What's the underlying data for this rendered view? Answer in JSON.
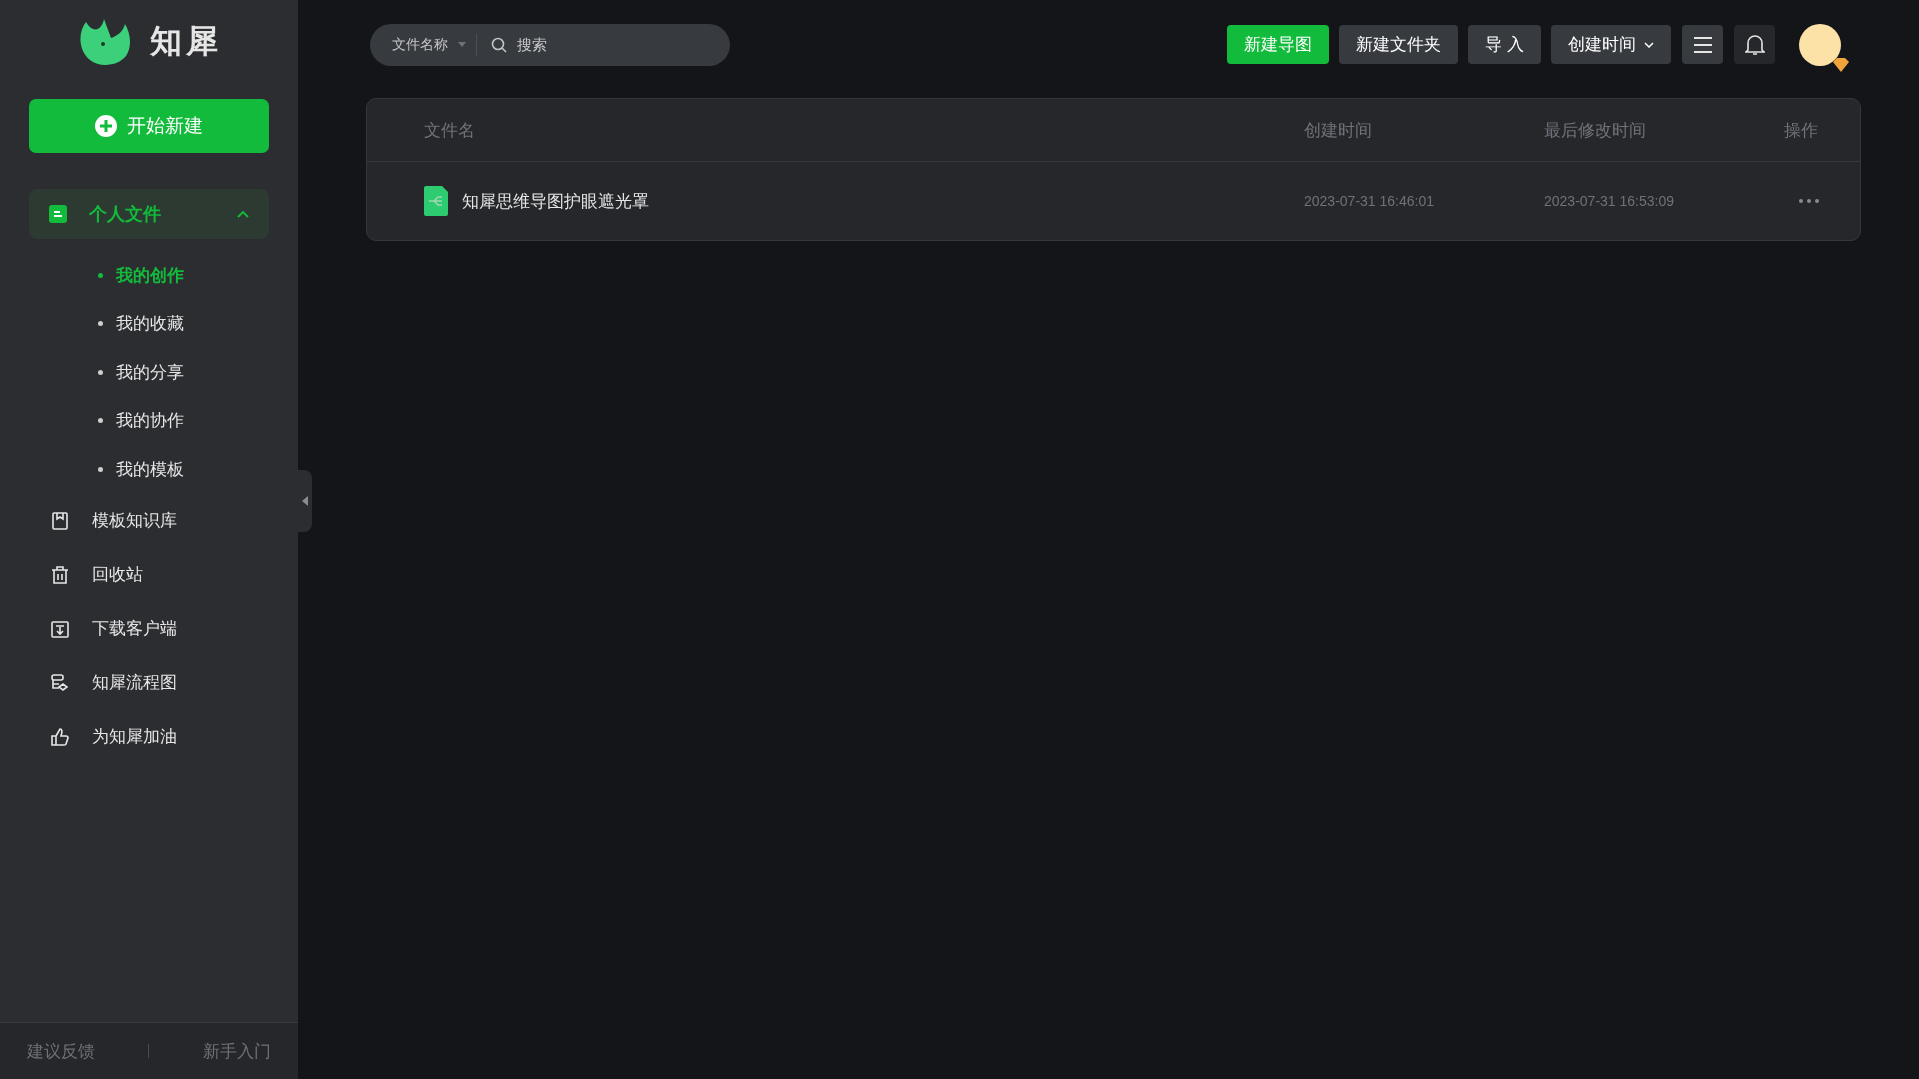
{
  "sidebar": {
    "logo_text": "知犀",
    "new_button": "开始新建",
    "group": {
      "label": "个人文件",
      "expanded": true,
      "selected": true,
      "children": [
        {
          "label": "我的创作",
          "selected": true
        },
        {
          "label": "我的收藏",
          "selected": false
        },
        {
          "label": "我的分享",
          "selected": false
        },
        {
          "label": "我的协作",
          "selected": false
        },
        {
          "label": "我的模板",
          "selected": false
        }
      ]
    },
    "items": [
      {
        "label": "模板知识库",
        "kind": "bookmark"
      },
      {
        "label": "回收站",
        "kind": "trash"
      },
      {
        "label": "下载客户端",
        "kind": "download"
      },
      {
        "label": "知犀流程图",
        "kind": "flow"
      },
      {
        "label": "为知犀加油",
        "kind": "like"
      }
    ],
    "footer": [
      "建议反馈",
      "新手入门"
    ]
  },
  "search": {
    "scope": "文件名称",
    "placeholder": "搜索"
  },
  "toolbar": [
    {
      "label": "新建导图",
      "kind": "primary"
    },
    {
      "label": "新建文件夹",
      "kind": "secondary"
    },
    {
      "label": "导 入",
      "kind": "secondary"
    },
    {
      "label": "创建时间",
      "kind": "dropdown"
    }
  ],
  "table": {
    "columns": [
      "文件名",
      "创建时间",
      "最后修改时间",
      "操作"
    ],
    "rows": [
      {
        "name": "知犀思维导图护眼遮光罩",
        "created": "2023-07-31 16:46:01",
        "modified": "2023-07-31 16:53:09"
      }
    ]
  }
}
